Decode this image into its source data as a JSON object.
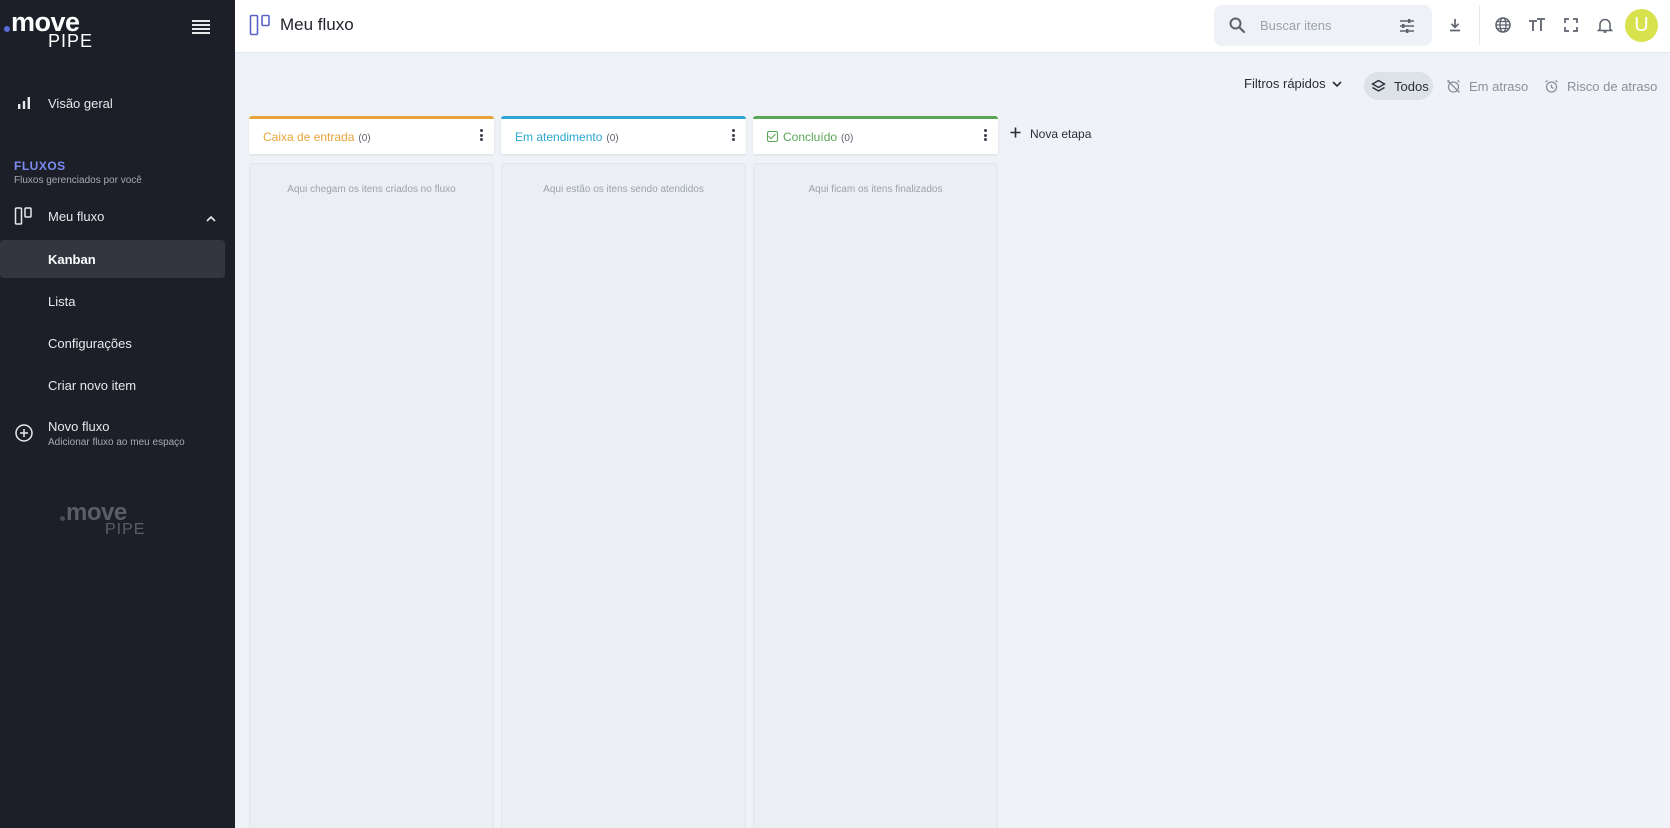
{
  "brand": {
    "logo_main": "move",
    "logo_sub": "PIPE"
  },
  "sidebar": {
    "overview_label": "Visão geral",
    "section_title": "FLUXOS",
    "section_subtitle": "Fluxos gerenciados por você",
    "flow": {
      "label": "Meu fluxo"
    },
    "items": [
      {
        "label": "Kanban",
        "active": true
      },
      {
        "label": "Lista"
      },
      {
        "label": "Configurações"
      },
      {
        "label": "Criar novo item"
      }
    ],
    "new_flow": {
      "label": "Novo fluxo",
      "sublabel": "Adicionar fluxo ao meu espaço"
    }
  },
  "header": {
    "title": "Meu fluxo",
    "search": {
      "placeholder": "Buscar itens",
      "value": ""
    },
    "avatar_initial": "U"
  },
  "filters": {
    "quick_label": "Filtros rápidos",
    "options": [
      {
        "label": "Todos",
        "selected": true
      },
      {
        "label": "Em atraso"
      },
      {
        "label": "Risco de atraso"
      }
    ]
  },
  "columns": [
    {
      "name": "Caixa de entrada",
      "count": "(0)",
      "color": "#e8a53a",
      "empty": "Aqui chegam os itens criados no fluxo"
    },
    {
      "name": "Em atendimento",
      "count": "(0)",
      "color": "#2ea6cf",
      "empty": "Aqui estão os itens sendo atendidos"
    },
    {
      "name": "Concluído",
      "count": "(0)",
      "color": "#5aa657",
      "empty": "Aqui ficam os itens finalizados"
    }
  ],
  "new_stage_label": "Nova etapa",
  "icons": [
    "menu-icon",
    "bar-chart-icon",
    "kanban-icon",
    "chevron-up-icon",
    "add-circle-icon",
    "search-icon",
    "tune-icon",
    "download-icon",
    "globe-icon",
    "text-size-icon",
    "fullscreen-icon",
    "bell-icon",
    "chevron-down-icon",
    "layers-icon",
    "alarm-off-icon",
    "alarm-icon",
    "more-vertical-icon",
    "plus-icon",
    "check-box-icon"
  ],
  "colors": {
    "sidebar_bg": "#1c1f27",
    "accent": "#7b8cf2",
    "avatar": "#d8e24e"
  }
}
